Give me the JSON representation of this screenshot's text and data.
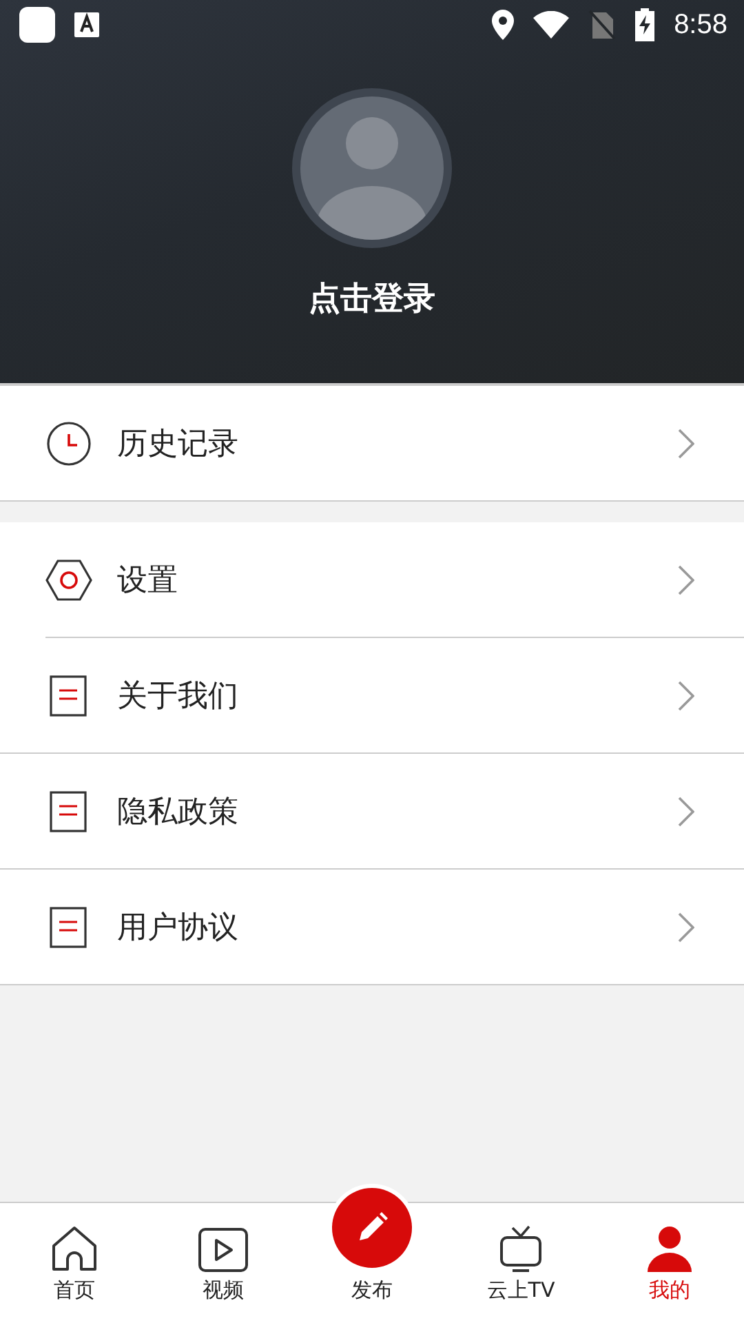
{
  "status_bar": {
    "time": "8:58"
  },
  "profile": {
    "login_label": "点击登录"
  },
  "menu_groups": [
    {
      "items": [
        {
          "kind": "clock",
          "label": "历史记录"
        }
      ]
    },
    {
      "items": [
        {
          "kind": "hexagon",
          "label": "设置"
        },
        {
          "kind": "document",
          "label": "关于我们"
        },
        {
          "kind": "document",
          "label": "隐私政策"
        },
        {
          "kind": "document",
          "label": "用户协议"
        }
      ]
    }
  ],
  "bottom_nav": [
    {
      "kind": "home",
      "label": "首页",
      "selected": false
    },
    {
      "kind": "video",
      "label": "视频",
      "selected": false
    },
    {
      "kind": "publish",
      "label": "发布",
      "selected": false
    },
    {
      "kind": "tv",
      "label": "云上TV",
      "selected": false
    },
    {
      "kind": "person",
      "label": "我的",
      "selected": true
    }
  ]
}
